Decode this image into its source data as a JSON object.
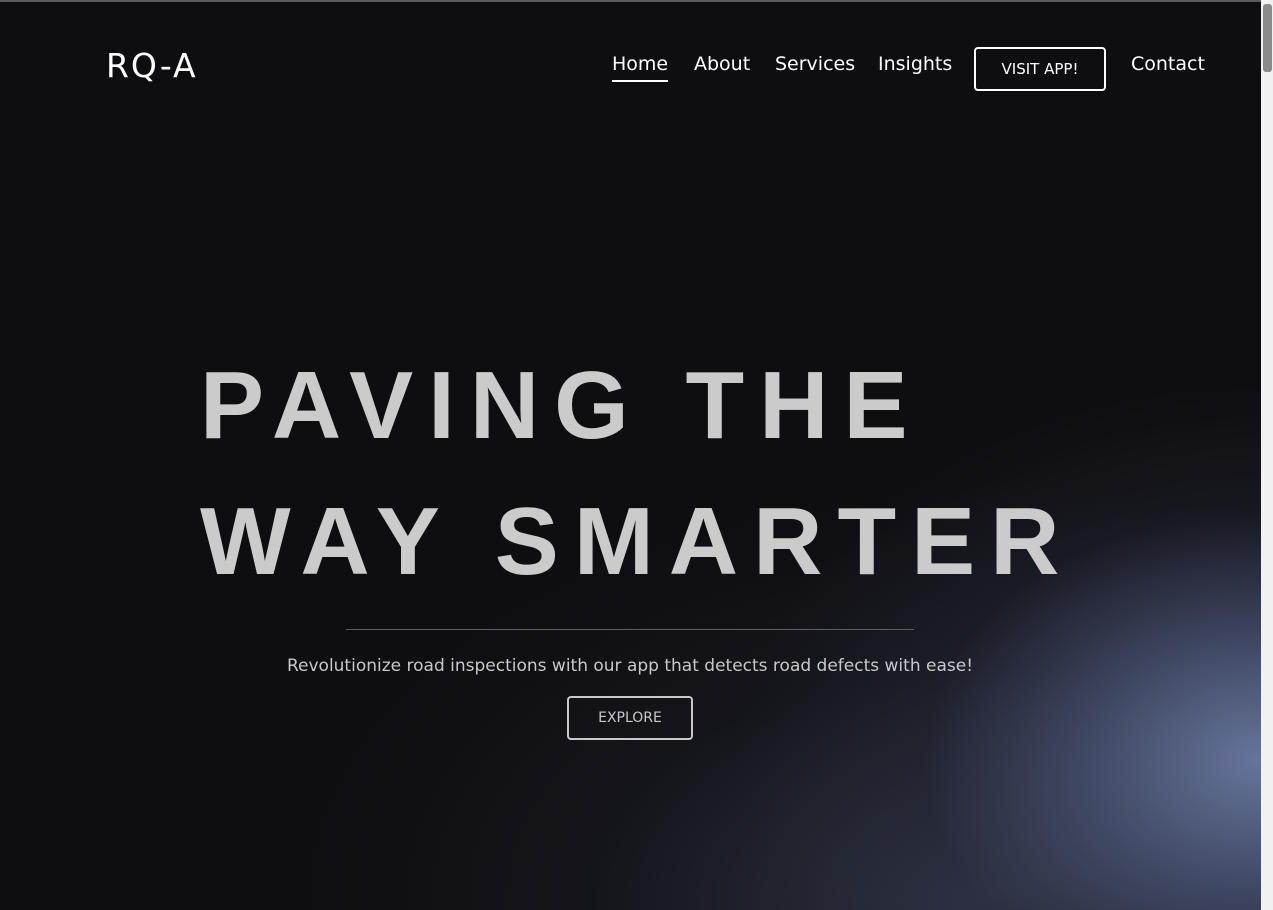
{
  "brand": {
    "logo_text": "RQ-A"
  },
  "nav": {
    "items": [
      {
        "label": "Home",
        "active": true
      },
      {
        "label": "About",
        "active": false
      },
      {
        "label": "Services",
        "active": false
      },
      {
        "label": "Insights",
        "active": false
      }
    ],
    "cta_label": "VISIT APP!",
    "contact_label": "Contact"
  },
  "hero": {
    "title_line_1": "PAVING THE",
    "title_line_2": "WAY SMARTER",
    "subtitle": "Revolutionize road inspections with our app that detects road defects with ease!",
    "button_label": "EXPLORE"
  },
  "colors": {
    "background": "#0e0d10",
    "glow": "#6c7aa2",
    "title_text": "#cbcbcb",
    "nav_text": "#ffffff"
  }
}
